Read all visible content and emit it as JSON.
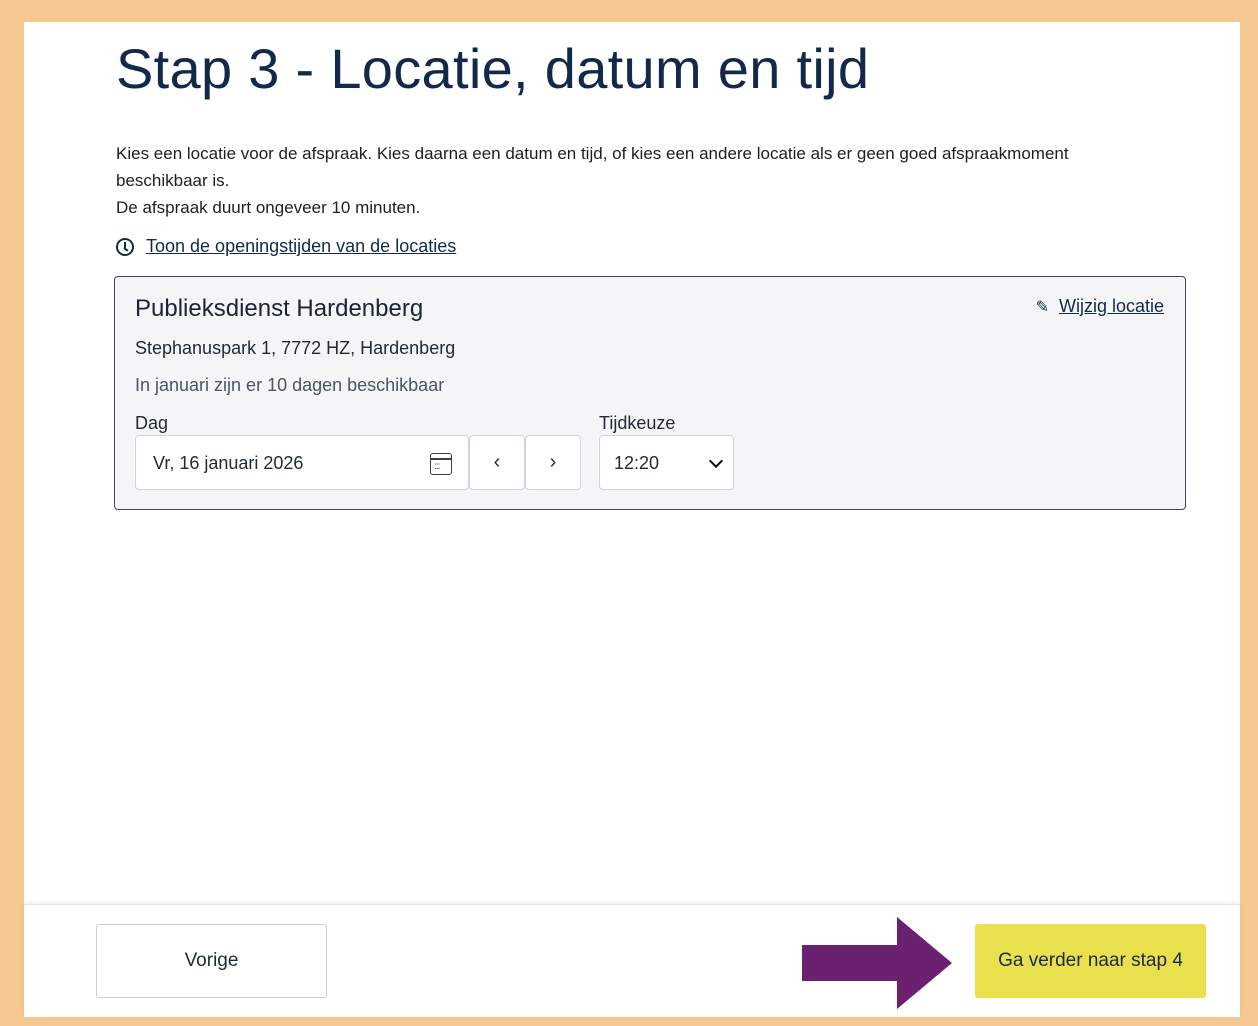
{
  "header": {
    "title": "Stap 3 - Locatie, datum en tijd",
    "intro_line1": "Kies een locatie voor de afspraak. Kies daarna een datum en tijd, of kies een andere locatie als er geen goed afspraakmoment beschikbaar is.",
    "intro_line2": "De afspraak duurt ongeveer 10 minuten.",
    "hours_link": "Toon de openingstijden van de locaties"
  },
  "location": {
    "name": "Publieksdienst Hardenberg",
    "change_label": "Wijzig locatie",
    "address": "Stephanuspark 1, 7772 HZ, Hardenberg",
    "availability": "In januari zijn er 10 dagen beschikbaar",
    "day_label": "Dag",
    "day_value": "Vr, 16 januari 2026",
    "prev_symbol": "‹",
    "next_symbol": "›",
    "time_label": "Tijdkeuze",
    "time_value": "12:20"
  },
  "footer": {
    "prev_label": "Vorige",
    "next_label": "Ga verder naar stap 4"
  },
  "colors": {
    "frame": "#f6c892",
    "heading": "#13294b",
    "next_button": "#e8e14d",
    "arrow": "#6b2170"
  },
  "icons": [
    "clock-icon",
    "pencil-icon",
    "calendar-icon",
    "chevron-down-icon",
    "pointer-arrow-icon"
  ]
}
